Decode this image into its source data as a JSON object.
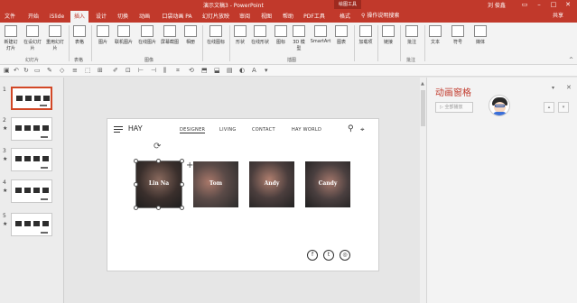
{
  "titlebar": {
    "title": "演示文稿3 - PowerPoint",
    "tools_label": "绘图工具",
    "user": "刘 俊鑫"
  },
  "menu": {
    "tabs": [
      {
        "label": "文件"
      },
      {
        "label": "开始"
      },
      {
        "label": "iSlide"
      },
      {
        "label": "插入"
      },
      {
        "label": "设计"
      },
      {
        "label": "切换"
      },
      {
        "label": "动画"
      },
      {
        "label": "口袋动画 PA"
      },
      {
        "label": "幻灯片放映"
      },
      {
        "label": "审阅"
      },
      {
        "label": "视图"
      },
      {
        "label": "帮助"
      },
      {
        "label": "PDF工具"
      },
      {
        "label": "格式"
      }
    ],
    "tell_me": "操作说明搜索",
    "share": "共享"
  },
  "ribbon": {
    "buttons": [
      {
        "label": "新建幻灯片"
      },
      {
        "label": "在设幻灯片"
      },
      {
        "label": "重用幻灯片"
      },
      {
        "label": "表格"
      },
      {
        "label": "图片"
      },
      {
        "label": "联机图片"
      },
      {
        "label": "在线图片"
      },
      {
        "label": "屏幕截图"
      },
      {
        "label": "相册"
      },
      {
        "label": "在线图标"
      },
      {
        "label": "形状"
      },
      {
        "label": "在线形状"
      },
      {
        "label": "图标"
      },
      {
        "label": "3D 模型"
      },
      {
        "label": "SmartArt"
      },
      {
        "label": "图表"
      },
      {
        "label": "加载项"
      },
      {
        "label": "链接"
      },
      {
        "label": "批注"
      },
      {
        "label": "文本"
      },
      {
        "label": "符号"
      },
      {
        "label": "媒体"
      }
    ],
    "groups": [
      {
        "label": "幻灯片"
      },
      {
        "label": "表格"
      },
      {
        "label": "图像"
      },
      {
        "label": "插图"
      },
      {
        "label": "批注"
      }
    ]
  },
  "thumbnails": [
    {
      "num": "1"
    },
    {
      "num": "2"
    },
    {
      "num": "3"
    },
    {
      "num": "4"
    },
    {
      "num": "5"
    }
  ],
  "slide": {
    "logo": "HAY",
    "nav": [
      "DESIGNER",
      "LIVING",
      "CONTACT",
      "HAY WORLD"
    ],
    "photos": [
      {
        "name": "Lin Na"
      },
      {
        "name": "Tom"
      },
      {
        "name": "Andy"
      },
      {
        "name": "Candy"
      }
    ],
    "social": [
      "f",
      "t",
      "◎"
    ]
  },
  "animation_pane": {
    "title": "动画窗格",
    "play_label": "全部播放"
  },
  "colors": {
    "accent": "#c1392b",
    "panel_title": "#c1392b"
  }
}
